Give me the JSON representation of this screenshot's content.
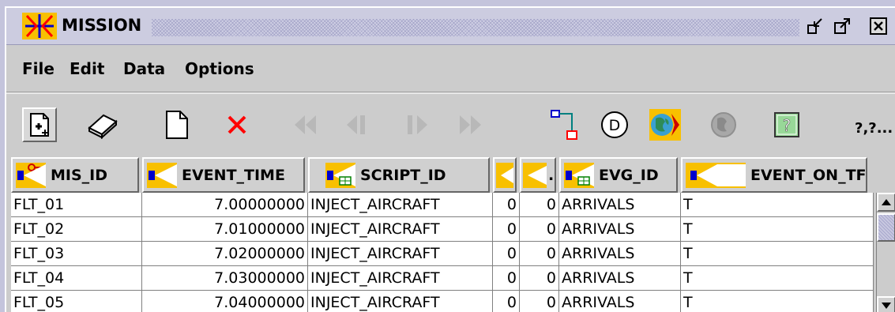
{
  "window": {
    "title": "MISSION",
    "buttons": [
      "restore-icon",
      "maximize-icon",
      "close-icon"
    ]
  },
  "menu": {
    "items": [
      "File",
      "Edit",
      "Data",
      "Options"
    ]
  },
  "toolbar": {
    "icons": [
      "new-record-icon",
      "eraser-icon",
      "blank-document-icon",
      "delete-x-icon",
      "first-record-icon",
      "previous-record-icon",
      "next-record-icon",
      "last-record-icon",
      "link-diagram-icon",
      "d-circle-icon",
      "globe-icon",
      "globe-disabled-icon",
      "help-icon"
    ],
    "overflow_label": "?,?..."
  },
  "table": {
    "columns": [
      {
        "label": "MIS_ID",
        "icon": "key-column-icon"
      },
      {
        "label": "EVENT_TIME",
        "icon": "column-icon"
      },
      {
        "label": "SCRIPT_ID",
        "icon": "lookup-column-icon"
      },
      {
        "label": "",
        "icon": "column-icon"
      },
      {
        "label": ".",
        "icon": "column-icon"
      },
      {
        "label": "EVG_ID",
        "icon": "lookup-column-icon"
      },
      {
        "label": "EVENT_ON_TF",
        "icon": "column-icon"
      }
    ],
    "rows": [
      [
        "FLT_01",
        "7.00000000",
        "INJECT_AIRCRAFT",
        "0",
        "0",
        "ARRIVALS",
        "T"
      ],
      [
        "FLT_02",
        "7.01000000",
        "INJECT_AIRCRAFT",
        "0",
        "0",
        "ARRIVALS",
        "T"
      ],
      [
        "FLT_03",
        "7.02000000",
        "INJECT_AIRCRAFT",
        "0",
        "0",
        "ARRIVALS",
        "T"
      ],
      [
        "FLT_04",
        "7.03000000",
        "INJECT_AIRCRAFT",
        "0",
        "0",
        "ARRIVALS",
        "T"
      ],
      [
        "FLT_05",
        "7.04000000",
        "INJECT_AIRCRAFT",
        "0",
        "0",
        "ARRIVALS",
        "T"
      ]
    ]
  },
  "colors": {
    "titlebar": "#cccce0",
    "background": "#cccccc",
    "accent_blue": "#0000cc",
    "accent_yellow": "#f8c000",
    "delete_red": "#ff0000"
  }
}
